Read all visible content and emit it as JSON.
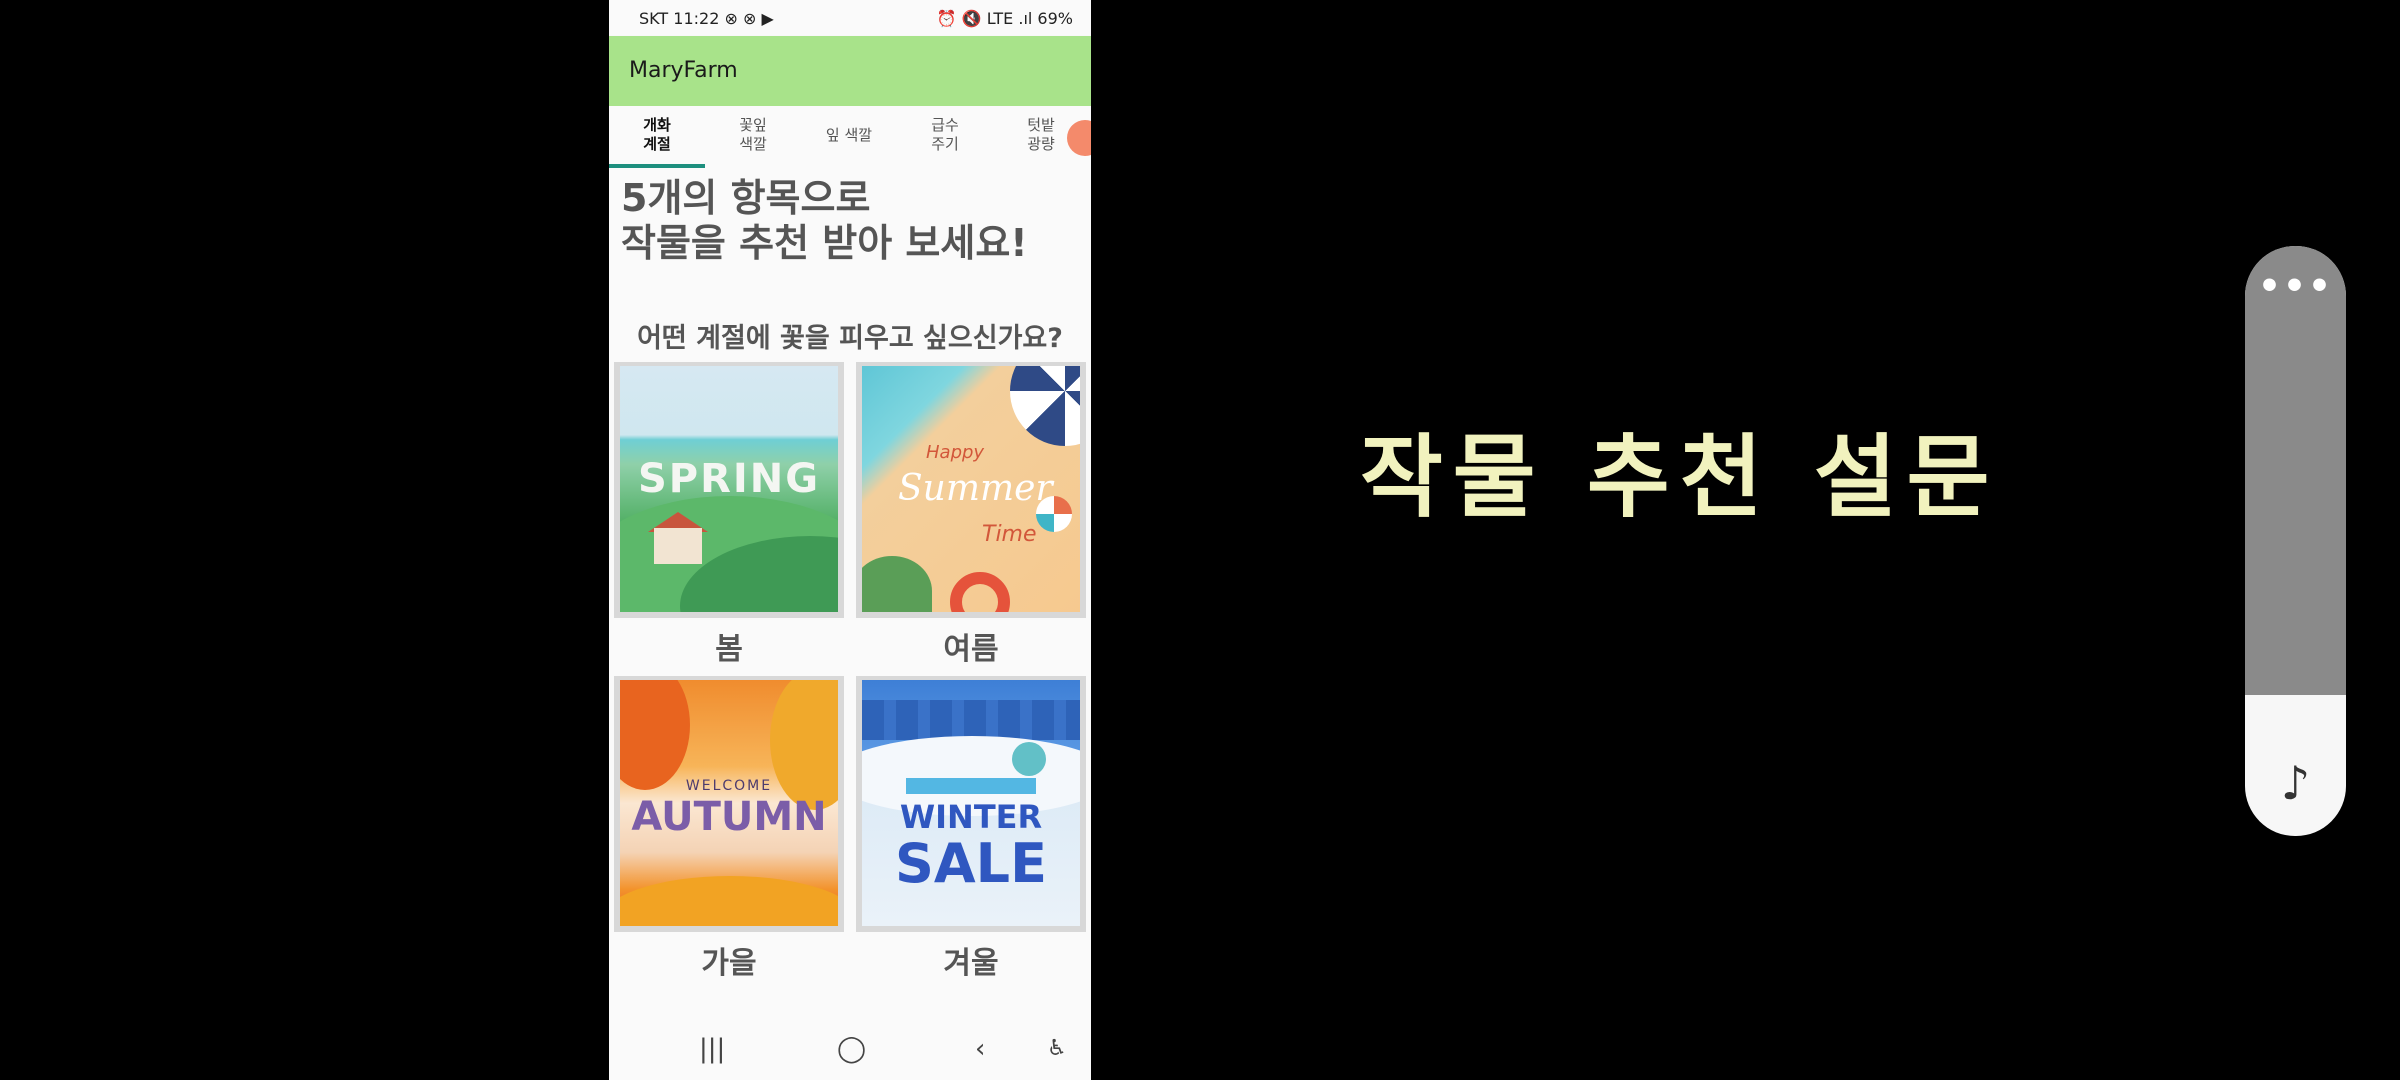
{
  "status_bar": {
    "left": "SKT 11:22 ⊗ ⊗ ▶",
    "right": "⏰ 🔇 LTE .ıl 69%"
  },
  "app": {
    "title": "MaryFarm"
  },
  "tabs": [
    {
      "label": "개화\n계절",
      "active": true
    },
    {
      "label": "꽃잎\n색깔",
      "active": false
    },
    {
      "label": "잎 색깔",
      "active": false
    },
    {
      "label": "급수\n주기",
      "active": false
    },
    {
      "label": "텃밭\n광량",
      "active": false
    }
  ],
  "headline": {
    "line1": "5개의 항목으로",
    "line2": "작물을 추천 받아 보세요!"
  },
  "question": "어떤 계절에 꽃을 피우고 싶으신가요?",
  "seasons": [
    {
      "label": "봄",
      "art_text": "SPRING"
    },
    {
      "label": "여름",
      "art_text_1": "Happy",
      "art_text_2": "Summer",
      "art_text_3": "Time"
    },
    {
      "label": "가을",
      "art_text_1": "WELCOME",
      "art_text_2": "AUTUMN"
    },
    {
      "label": "겨울",
      "art_text_1": "WINTER",
      "art_text_2": "SALE"
    }
  ],
  "nav": {
    "recents": "|||",
    "home": "◯",
    "back": "‹",
    "accessibility": "♿"
  },
  "caption": "작물 추천 설문",
  "float_panel": {
    "more": "•••",
    "note": "♪"
  },
  "colors": {
    "appbar": "#a8e38a",
    "tab_indicator": "#1d8f7e",
    "caption": "#f1f2be"
  }
}
